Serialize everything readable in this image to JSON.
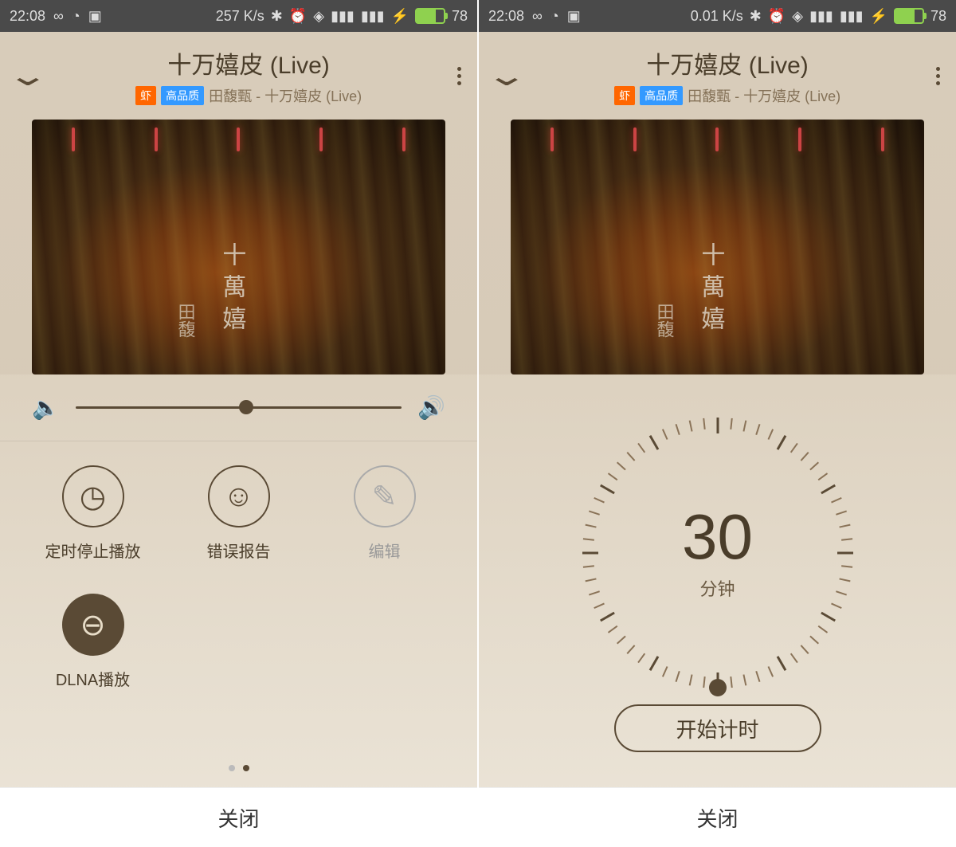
{
  "left": {
    "status": {
      "time": "22:08",
      "speed": "257 K/s",
      "battery": "78"
    },
    "header": {
      "title": "十万嬉皮 (Live)",
      "badge1": "虾",
      "badge2": "高品质",
      "subtitle": "田馥甄 - 十万嬉皮 (Live)"
    },
    "album": {
      "main": "十萬嬉",
      "side": "田馥"
    },
    "options": {
      "timer": "定时停止播放",
      "error": "错误报告",
      "edit": "编辑",
      "dlna": "DLNA播放"
    },
    "close": "关闭"
  },
  "right": {
    "status": {
      "time": "22:08",
      "speed": "0.01 K/s",
      "battery": "78"
    },
    "header": {
      "title": "十万嬉皮 (Live)",
      "badge1": "虾",
      "badge2": "高品质",
      "subtitle": "田馥甄 - 十万嬉皮 (Live)"
    },
    "album": {
      "main": "十萬嬉",
      "side": "田馥"
    },
    "timer": {
      "value": "30",
      "unit": "分钟",
      "start": "开始计时"
    },
    "close": "关闭"
  }
}
